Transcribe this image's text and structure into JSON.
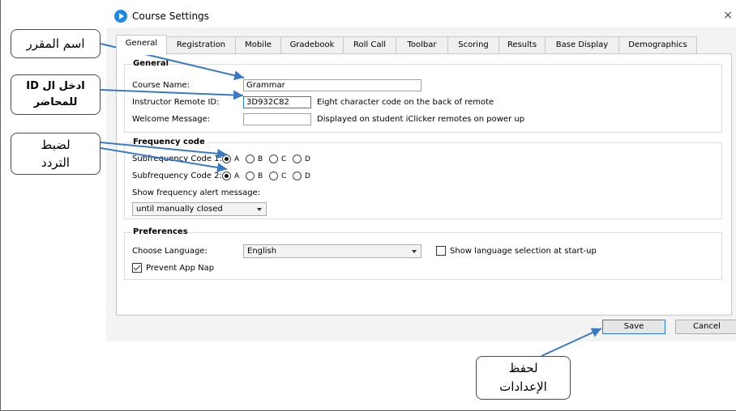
{
  "window": {
    "title": "Course Settings",
    "close_glyph": "×"
  },
  "tabs": [
    {
      "label": "General",
      "active": true
    },
    {
      "label": "Registration"
    },
    {
      "label": "Mobile"
    },
    {
      "label": "Gradebook"
    },
    {
      "label": "Roll Call"
    },
    {
      "label": "Toolbar"
    },
    {
      "label": "Scoring"
    },
    {
      "label": "Results"
    },
    {
      "label": "Base Display"
    },
    {
      "label": "Demographics"
    }
  ],
  "general": {
    "title": "General",
    "course_name_label": "Course Name:",
    "course_name_value": "Grammar",
    "remote_id_label": "Instructor Remote ID:",
    "remote_id_value": "3D932C82",
    "remote_id_hint": "Eight character code on the back of remote",
    "welcome_label": "Welcome Message:",
    "welcome_value": "",
    "welcome_hint": "Displayed on student iClicker remotes on power up"
  },
  "frequency": {
    "title": "Frequency code",
    "sub1_label": "Subfrequency Code 1:",
    "sub2_label": "Subfrequency Code 2:",
    "options": [
      "A",
      "B",
      "C",
      "D"
    ],
    "sub1_selected": "A",
    "sub2_selected": "A",
    "alert_label": "Show frequency alert message:",
    "alert_value": "until manually closed"
  },
  "preferences": {
    "title": "Preferences",
    "language_label": "Choose Language:",
    "language_value": "English",
    "show_language_label": "Show language selection at start-up",
    "show_language_checked": false,
    "prevent_nap_label": "Prevent App Nap",
    "prevent_nap_checked": true
  },
  "buttons": {
    "save": "Save",
    "cancel": "Cancel"
  },
  "callouts": {
    "course_name": "اسم المقرر",
    "enter_id_line1": "ادخل ال ID",
    "enter_id_line2": "للمحاضر",
    "frequency_line1": "لضبط",
    "frequency_line2": "التردد",
    "save_line1": "لحفظ",
    "save_line2": "الإعدادات"
  },
  "colors": {
    "accent": "#2a7ae2",
    "arrow": "#3a79c4",
    "app_icon": "#1e88e5"
  }
}
